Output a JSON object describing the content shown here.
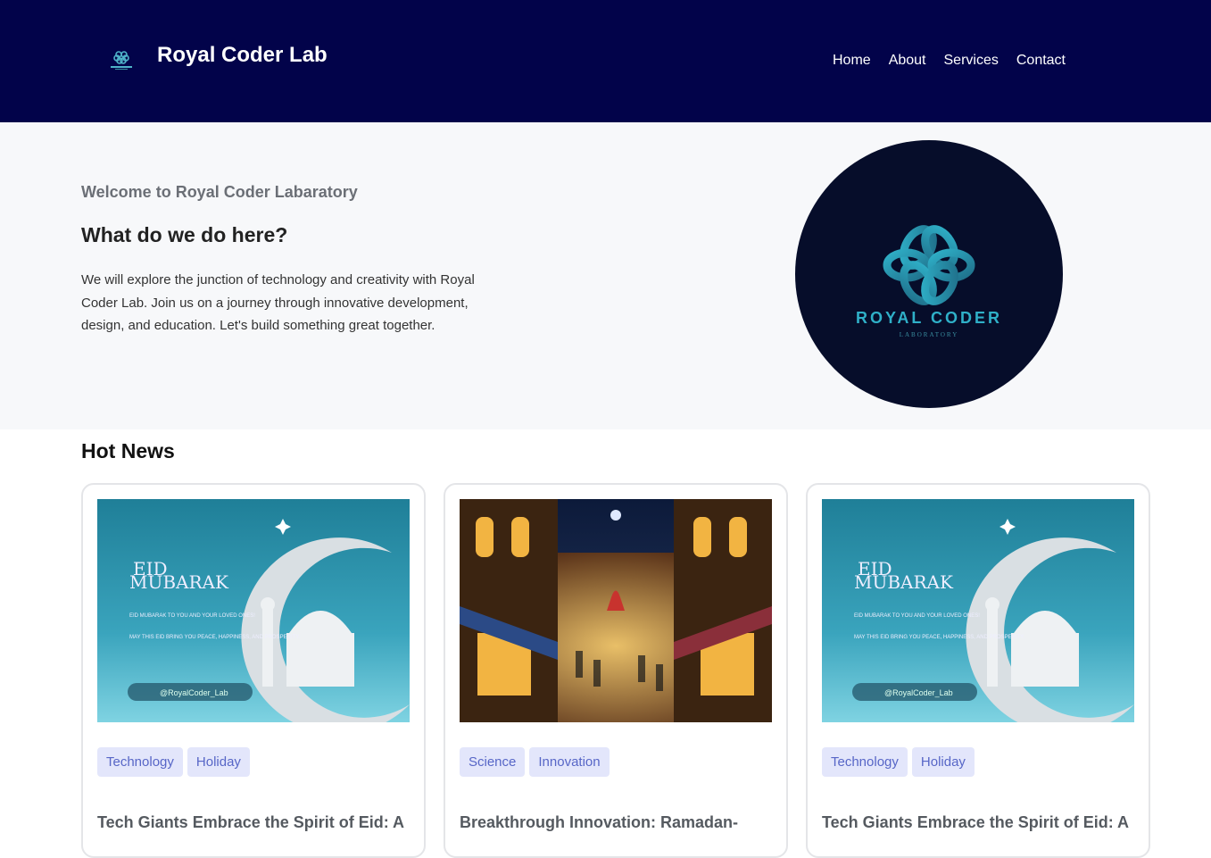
{
  "header": {
    "title": "Royal Coder Lab",
    "nav": [
      "Home",
      "About",
      "Services",
      "Contact"
    ],
    "background": "#02034a"
  },
  "hero": {
    "welcome": "Welcome to Royal Coder Labaratory",
    "question": "What do we do here?",
    "description": "We will explore the junction of technology and creativity with Royal Coder Lab. Join us on a journey through innovative development, design, and education. Let's build something great together.",
    "logo_text": "ROYAL CODER",
    "logo_subtext": "LABORATORY"
  },
  "news": {
    "title": "Hot News",
    "cards": [
      {
        "tags": [
          "Technology",
          "Holiday"
        ],
        "title": "Tech Giants Embrace the Spirit of Eid: A",
        "image": {
          "heading_line1": "EID",
          "heading_line2": "MUBARAK",
          "text1": "EID MUBARAK TO YOU AND YOUR LOVED ONES!",
          "text2": "MAY THIS EID BRING YOU PEACE, HAPPINESS, AND PROSPERITY.",
          "handle": "@RoyalCoder_Lab"
        }
      },
      {
        "tags": [
          "Science",
          "Innovation"
        ],
        "title": "Breakthrough Innovation: Ramadan-"
      },
      {
        "tags": [
          "Technology",
          "Holiday"
        ],
        "title": "Tech Giants Embrace the Spirit of Eid: A",
        "image": {
          "heading_line1": "EID",
          "heading_line2": "MUBARAK",
          "text1": "EID MUBARAK TO YOU AND YOUR LOVED ONES!",
          "text2": "MAY THIS EID BRING YOU PEACE, HAPPINESS, AND PROSPERITY.",
          "handle": "@RoyalCoder_Lab"
        }
      }
    ]
  }
}
